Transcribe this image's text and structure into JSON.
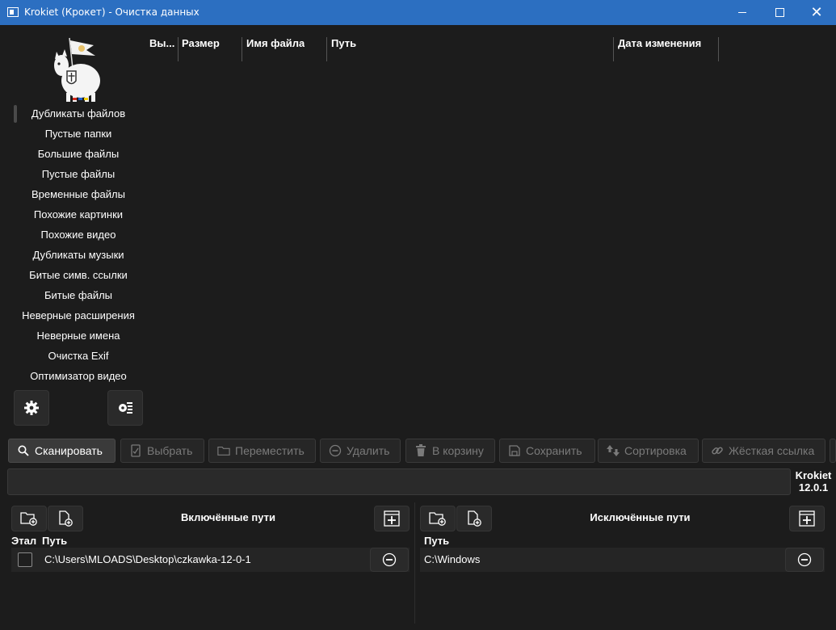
{
  "window": {
    "title": "Krokiet (Крокет) - Очистка данных",
    "minimize_icon": "minimize-icon",
    "maximize_icon": "maximize-icon",
    "close_glyph": "✕"
  },
  "sidebar": {
    "logo": "krokiet-llama-logo",
    "items": [
      {
        "label": "Дубликаты файлов",
        "active": true
      },
      {
        "label": "Пустые папки"
      },
      {
        "label": "Большие файлы"
      },
      {
        "label": "Пустые файлы"
      },
      {
        "label": "Временные файлы"
      },
      {
        "label": "Похожие картинки"
      },
      {
        "label": "Похожие видео"
      },
      {
        "label": "Дубликаты музыки"
      },
      {
        "label": "Битые симв. ссылки"
      },
      {
        "label": "Битые файлы"
      },
      {
        "label": "Неверные расширения"
      },
      {
        "label": "Неверные имена"
      },
      {
        "label": "Очистка Exif"
      },
      {
        "label": "Оптимизатор видео"
      }
    ],
    "settings_icon": "gear-icon",
    "settings_list_icon": "settings-list-icon"
  },
  "table": {
    "columns": [
      "Вы...",
      "Размер",
      "Имя файла",
      "Путь",
      "Дата изменения"
    ]
  },
  "toolbar": {
    "scan": "Сканировать",
    "select": "Выбрать",
    "move": "Переместить",
    "delete": "Удалить",
    "trash": "В корзину",
    "save": "Сохранить",
    "sort": "Сортировка",
    "hardlink": "Жёсткая ссылка"
  },
  "status": {
    "app_name": "Krokiet",
    "version": "12.0.1"
  },
  "included": {
    "title": "Включённые пути",
    "col_reference": "Этал",
    "col_path": "Путь",
    "rows": [
      {
        "checked": false,
        "path": "C:\\Users\\MLOADS\\Desktop\\czkawka-12-0-1"
      }
    ]
  },
  "excluded": {
    "title": "Исключённые пути",
    "col_path": "Путь",
    "rows": [
      {
        "path": "C:\\Windows"
      }
    ]
  },
  "colors": {
    "titlebar": "#2c6fc1",
    "background": "#1c1c1c",
    "button": "#2a2a2a",
    "disabled_text": "#7a7a7a"
  }
}
